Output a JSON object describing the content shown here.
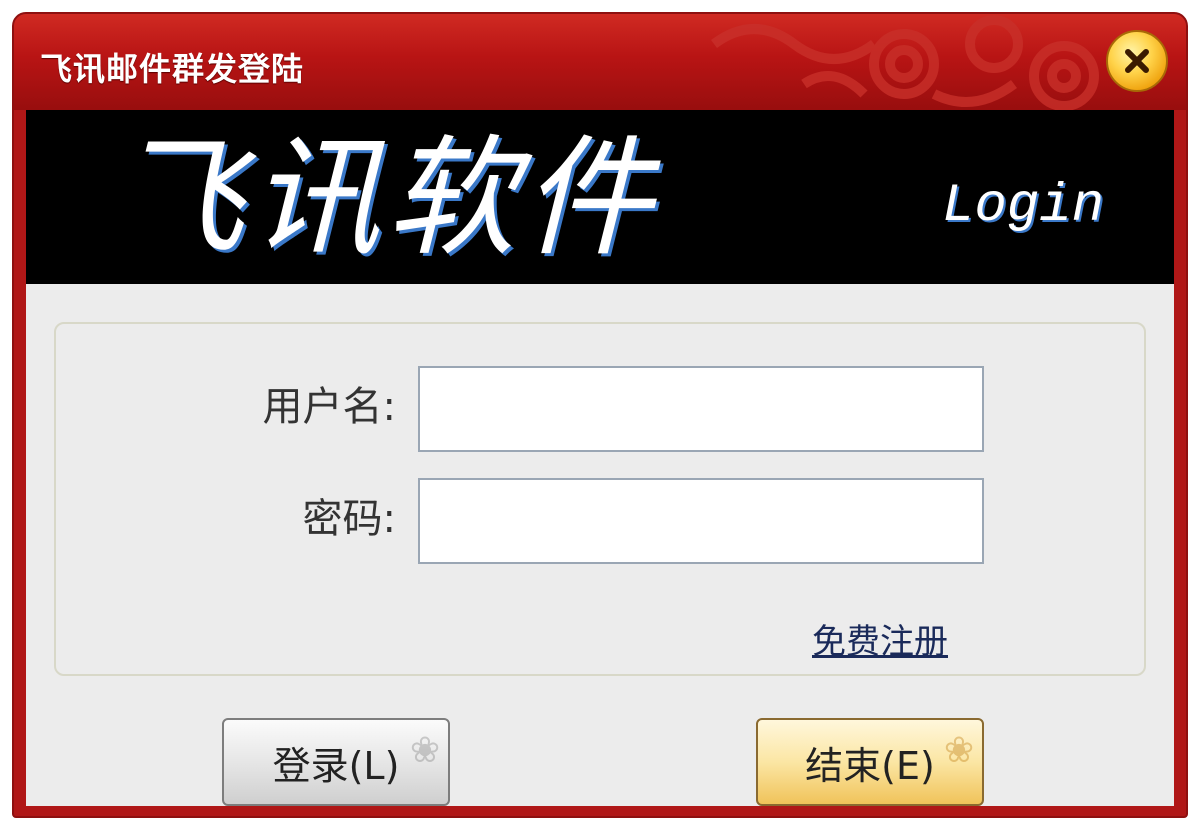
{
  "window": {
    "title": "飞讯邮件群发登陆",
    "close_icon": "close-icon"
  },
  "banner": {
    "title": "飞讯软件",
    "subtitle": "Login"
  },
  "form": {
    "username_label": "用户名:",
    "username_value": "",
    "password_label": "密码:",
    "password_value": "",
    "register_link": "免费注册"
  },
  "buttons": {
    "login_label": "登录(L)",
    "exit_label": "结束(E)"
  },
  "colors": {
    "titlebar": "#b81414",
    "banner_bg": "#000000",
    "content_bg": "#ececec",
    "close_button": "#ffd34a"
  }
}
